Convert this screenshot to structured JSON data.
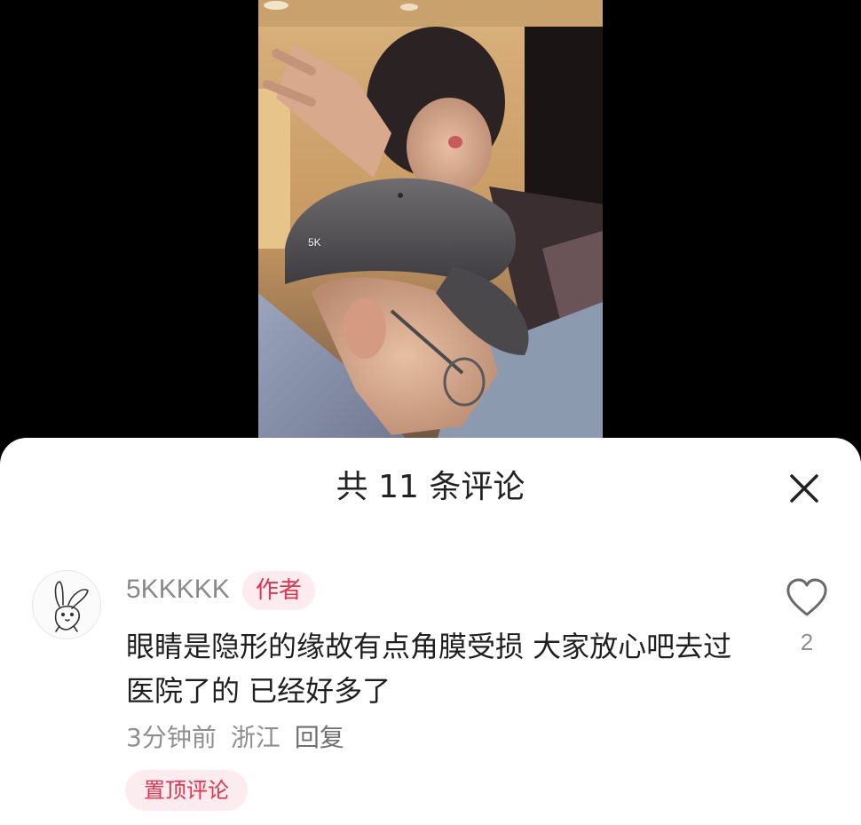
{
  "video": {
    "watermark": "5K"
  },
  "comments_panel": {
    "title": "共 11 条评论",
    "close_icon": "close-icon"
  },
  "comment": {
    "username": "5KKKKK",
    "author_badge": "作者",
    "avatar_icon": "rabbit-doodle-avatar",
    "text": "眼睛是隐形的缘故有点角膜受损 大家放心吧去过医院了的 已经好多了",
    "time": "3分钟前",
    "location": "浙江",
    "reply_label": "回复",
    "pinned_label": "置顶评论",
    "like_icon": "heart-outline-icon",
    "like_count": "2"
  },
  "colors": {
    "badge_bg": "#fdecef",
    "badge_text": "#e0344f",
    "sheet_bg": "#ffffff",
    "backdrop": "#000000"
  }
}
